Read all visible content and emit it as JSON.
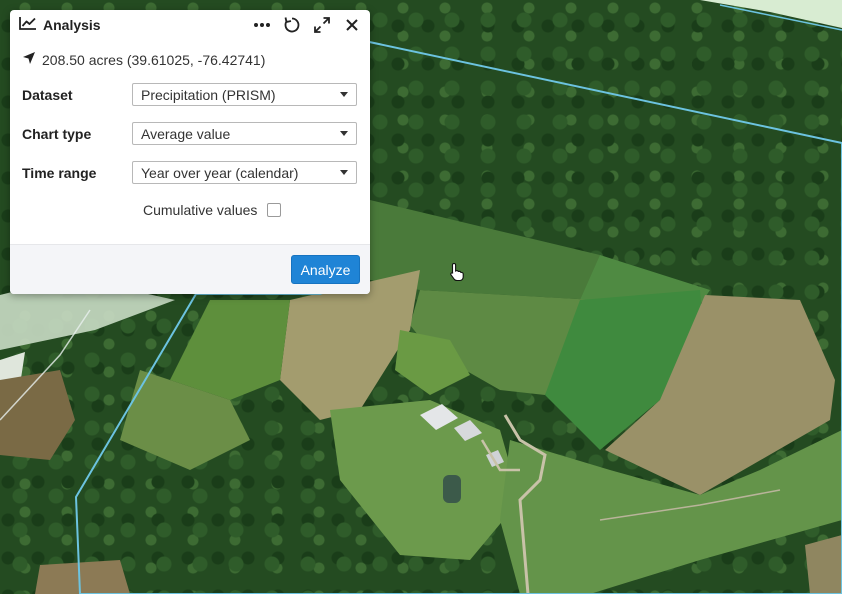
{
  "panel": {
    "title": "Analysis",
    "area_text": "208.50 acres (39.61025, -76.42741)",
    "fields": [
      {
        "label": "Dataset",
        "value": "Precipitation (PRISM)"
      },
      {
        "label": "Chart type",
        "value": "Average value"
      },
      {
        "label": "Time range",
        "value": "Year over year (calendar)"
      }
    ],
    "cumulative_label": "Cumulative values",
    "cumulative_checked": false,
    "analyze_label": "Analyze"
  },
  "colors": {
    "accent": "#1f84d6",
    "parcel_outline": "#6cc3e0"
  },
  "icons": {
    "title": "line-chart-icon",
    "location": "navigation-arrow-icon",
    "more": "more-dots-icon",
    "reset": "refresh-icon",
    "expand": "expand-icon",
    "close": "close-icon"
  }
}
